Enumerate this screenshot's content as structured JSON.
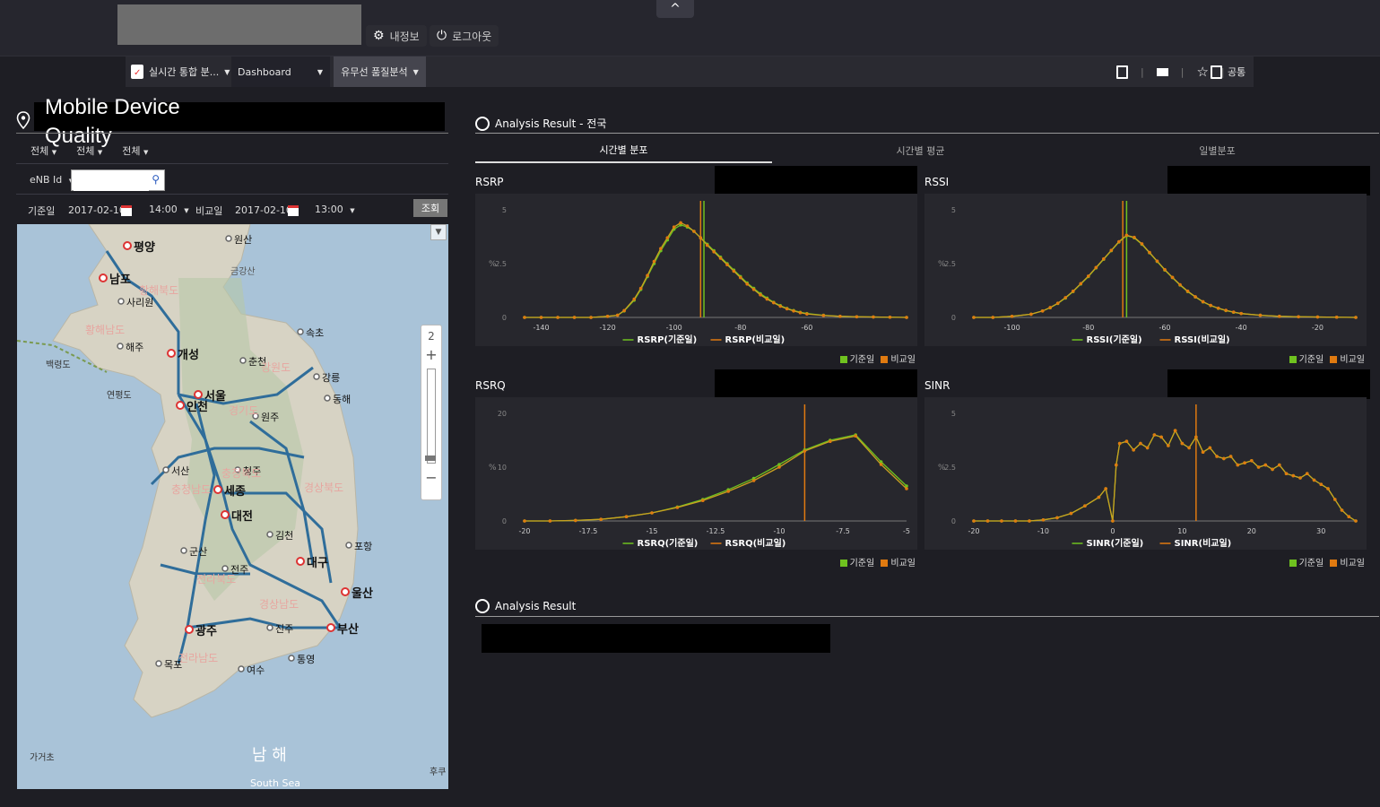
{
  "header": {
    "my_info": "내정보",
    "logout": "로그아웃",
    "collapse": "^"
  },
  "menu": {
    "realtime": "실시간 통합 분...",
    "dashboard": "Dashboard",
    "analysis": "유무선 품질분석",
    "common": "공통"
  },
  "left": {
    "title": "Mobile Device Quality",
    "filters": [
      "전체",
      "전체",
      "전체"
    ],
    "enb_label": "eNB Id",
    "enb_value": "",
    "base_label": "기준일",
    "base_date": "2017-02-10",
    "base_time": "14:00",
    "compare_label": "비교일",
    "compare_date": "2017-02-10",
    "compare_time": "13:00",
    "query_button": "조회",
    "zoom_level": "2",
    "zoom_in": "+",
    "zoom_out": "−"
  },
  "map": {
    "sea_label": "남 해",
    "sea_label_en": "South Sea",
    "cities": [
      {
        "name": "평양"
      },
      {
        "name": "남포"
      },
      {
        "name": "사리원"
      },
      {
        "name": "원산"
      },
      {
        "name": "금강산"
      },
      {
        "name": "개성"
      },
      {
        "name": "해주"
      },
      {
        "name": "춘천"
      },
      {
        "name": "속초"
      },
      {
        "name": "강릉"
      },
      {
        "name": "서울"
      },
      {
        "name": "인천"
      },
      {
        "name": "원주"
      },
      {
        "name": "동해"
      },
      {
        "name": "세종"
      },
      {
        "name": "대전"
      },
      {
        "name": "청주"
      },
      {
        "name": "김천"
      },
      {
        "name": "대구"
      },
      {
        "name": "포항"
      },
      {
        "name": "울산"
      },
      {
        "name": "부산"
      },
      {
        "name": "군산"
      },
      {
        "name": "전주"
      },
      {
        "name": "광주"
      },
      {
        "name": "목포"
      },
      {
        "name": "여수"
      },
      {
        "name": "진주"
      },
      {
        "name": "통영"
      },
      {
        "name": "서산"
      },
      {
        "name": "백령도"
      },
      {
        "name": "연평도"
      },
      {
        "name": "가거초"
      },
      {
        "name": "후쿠"
      }
    ],
    "regions": [
      "황해북도",
      "황해남도",
      "강원도",
      "경기도",
      "충청북도",
      "충청남도",
      "경상북도",
      "전라북도",
      "경상남도",
      "전라남도"
    ]
  },
  "analysis": {
    "title": "Analysis Result - 전국",
    "tabs": [
      "시간별 분포",
      "시간별 평균",
      "일별분포"
    ],
    "active_tab": 0,
    "bottom_title": "Analysis Result",
    "legend_base": "기준일",
    "legend_compare": "비교일"
  },
  "colors": {
    "base": "#6fc21f",
    "compare": "#e07a10",
    "line": "#c9a020",
    "accent": "#ffffff"
  },
  "chart_data": [
    {
      "type": "line",
      "title": "RSRP",
      "ylabel": "%",
      "xlim": [
        -145,
        -30
      ],
      "ylim": [
        0,
        5
      ],
      "xticks": [
        -140,
        -120,
        -100,
        -80,
        -60
      ],
      "yticks": [
        0,
        2.5,
        5
      ],
      "series": [
        {
          "name": "RSRP(기준일)"
        },
        {
          "name": "RSRP(비교일)"
        }
      ],
      "x": [
        -145,
        -140,
        -135,
        -130,
        -125,
        -120,
        -117,
        -115,
        -112,
        -110,
        -108,
        -106,
        -104,
        -102,
        -100,
        -98,
        -96,
        -94,
        -92,
        -90,
        -88,
        -86,
        -84,
        -82,
        -80,
        -78,
        -76,
        -74,
        -72,
        -70,
        -68,
        -66,
        -64,
        -62,
        -60,
        -55,
        -50,
        -45,
        -40,
        -35,
        -30
      ],
      "y_base": [
        0,
        0,
        0,
        0,
        0,
        0.05,
        0.1,
        0.3,
        0.8,
        1.3,
        1.9,
        2.5,
        3.1,
        3.6,
        4.1,
        4.3,
        4.2,
        4.0,
        3.7,
        3.4,
        3.1,
        2.8,
        2.5,
        2.2,
        1.9,
        1.6,
        1.35,
        1.1,
        0.9,
        0.7,
        0.55,
        0.42,
        0.32,
        0.24,
        0.18,
        0.1,
        0.05,
        0.03,
        0.02,
        0.01,
        0
      ],
      "y_compare": [
        0,
        0,
        0,
        0,
        0,
        0.05,
        0.1,
        0.32,
        0.85,
        1.35,
        1.95,
        2.6,
        3.2,
        3.7,
        4.2,
        4.4,
        4.25,
        4.0,
        3.7,
        3.35,
        3.05,
        2.75,
        2.45,
        2.15,
        1.85,
        1.55,
        1.3,
        1.05,
        0.85,
        0.68,
        0.52,
        0.4,
        0.3,
        0.22,
        0.16,
        0.09,
        0.05,
        0.03,
        0.02,
        0.01,
        0
      ],
      "mark_base": -91,
      "mark_compare": -92
    },
    {
      "type": "line",
      "title": "RSSI",
      "ylabel": "%",
      "xlim": [
        -110,
        -10
      ],
      "ylim": [
        0,
        5
      ],
      "xticks": [
        -100,
        -80,
        -60,
        -40,
        -20
      ],
      "yticks": [
        0,
        2.5,
        5
      ],
      "series": [
        {
          "name": "RSSI(기준일)"
        },
        {
          "name": "RSSI(비교일)"
        }
      ],
      "x": [
        -110,
        -105,
        -100,
        -95,
        -92,
        -90,
        -88,
        -86,
        -84,
        -82,
        -80,
        -78,
        -76,
        -74,
        -72,
        -70,
        -68,
        -66,
        -64,
        -62,
        -60,
        -58,
        -56,
        -54,
        -52,
        -50,
        -48,
        -46,
        -44,
        -42,
        -40,
        -35,
        -30,
        -25,
        -20,
        -15,
        -10
      ],
      "y_base": [
        0,
        0,
        0.05,
        0.15,
        0.3,
        0.45,
        0.65,
        0.9,
        1.2,
        1.55,
        1.9,
        2.3,
        2.7,
        3.1,
        3.5,
        3.8,
        3.7,
        3.4,
        3.0,
        2.6,
        2.2,
        1.85,
        1.5,
        1.2,
        0.95,
        0.72,
        0.55,
        0.42,
        0.32,
        0.24,
        0.18,
        0.1,
        0.05,
        0.03,
        0.02,
        0.01,
        0
      ],
      "y_compare": [
        0,
        0,
        0.05,
        0.15,
        0.3,
        0.46,
        0.66,
        0.92,
        1.22,
        1.57,
        1.92,
        2.32,
        2.72,
        3.12,
        3.52,
        3.82,
        3.72,
        3.42,
        3.02,
        2.62,
        2.22,
        1.86,
        1.52,
        1.22,
        0.96,
        0.73,
        0.56,
        0.43,
        0.33,
        0.25,
        0.18,
        0.1,
        0.05,
        0.03,
        0.02,
        0.01,
        0
      ],
      "mark_base": -70,
      "mark_compare": -71
    },
    {
      "type": "line",
      "title": "RSRQ",
      "ylabel": "%",
      "xlim": [
        -20,
        -5
      ],
      "ylim": [
        0,
        20
      ],
      "xticks": [
        -20,
        -17.5,
        -15,
        -12.5,
        -10,
        -7.5,
        -5
      ],
      "yticks": [
        0,
        10,
        20
      ],
      "series": [
        {
          "name": "RSRQ(기준일)"
        },
        {
          "name": "RSRQ(비교일)"
        }
      ],
      "x": [
        -20,
        -19,
        -18,
        -17,
        -16,
        -15,
        -14,
        -13,
        -12,
        -11,
        -10,
        -9,
        -8,
        -7,
        -6,
        -5
      ],
      "y_base": [
        0,
        0,
        0.1,
        0.3,
        0.8,
        1.5,
        2.6,
        4.0,
        5.8,
        7.9,
        10.5,
        13.2,
        15.0,
        16.0,
        11.0,
        6.5
      ],
      "y_compare": [
        0,
        0,
        0.1,
        0.3,
        0.8,
        1.5,
        2.5,
        3.8,
        5.5,
        7.5,
        10.0,
        13.0,
        14.8,
        15.8,
        10.5,
        6.0
      ],
      "mark_compare": -9
    },
    {
      "type": "line",
      "title": "SINR",
      "ylabel": "%",
      "xlim": [
        -20,
        35
      ],
      "ylim": [
        0,
        5
      ],
      "xticks": [
        -20,
        -10,
        0,
        10,
        20,
        30
      ],
      "yticks": [
        0,
        2.5,
        5
      ],
      "series": [
        {
          "name": "SINR(기준일)"
        },
        {
          "name": "SINR(비교일)"
        }
      ],
      "x": [
        -20,
        -18,
        -16,
        -14,
        -12,
        -10,
        -8,
        -6,
        -4,
        -2,
        -1,
        0,
        0.5,
        1,
        2,
        3,
        4,
        5,
        6,
        7,
        8,
        9,
        10,
        11,
        12,
        13,
        14,
        15,
        16,
        17,
        18,
        19,
        20,
        21,
        22,
        23,
        24,
        25,
        26,
        27,
        28,
        29,
        30,
        31,
        32,
        33,
        34,
        35
      ],
      "y_base": [
        0,
        0,
        0,
        0,
        0,
        0.05,
        0.15,
        0.35,
        0.7,
        1.1,
        1.5,
        0,
        2.6,
        3.6,
        3.7,
        3.3,
        3.6,
        3.4,
        4.0,
        3.9,
        3.5,
        4.2,
        3.6,
        3.4,
        3.9,
        3.2,
        3.4,
        3.0,
        2.9,
        3.0,
        2.6,
        2.7,
        2.8,
        2.5,
        2.6,
        2.4,
        2.6,
        2.2,
        2.1,
        2.0,
        2.2,
        1.9,
        1.7,
        1.5,
        1.0,
        0.5,
        0.2,
        0
      ],
      "y_compare": [
        0,
        0,
        0,
        0,
        0,
        0.05,
        0.15,
        0.35,
        0.7,
        1.1,
        1.5,
        0,
        2.6,
        3.6,
        3.7,
        3.3,
        3.6,
        3.4,
        4.0,
        3.9,
        3.5,
        4.2,
        3.6,
        3.4,
        3.9,
        3.2,
        3.4,
        3.0,
        2.9,
        3.0,
        2.6,
        2.7,
        2.8,
        2.5,
        2.6,
        2.4,
        2.6,
        2.2,
        2.1,
        2.0,
        2.2,
        1.9,
        1.7,
        1.5,
        1.0,
        0.5,
        0.2,
        0
      ],
      "mark_compare": 12
    }
  ]
}
